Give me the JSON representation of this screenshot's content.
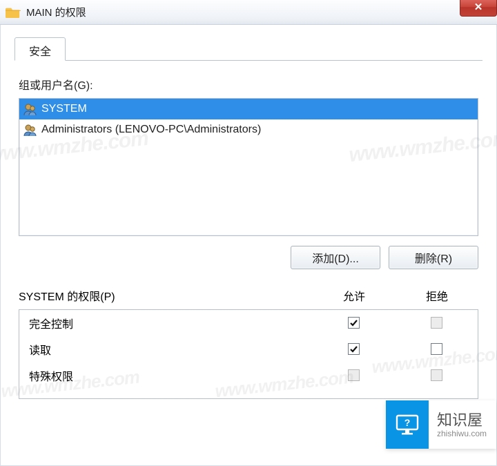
{
  "window": {
    "title": "MAIN 的权限",
    "close_glyph": "✕"
  },
  "tab": {
    "security": "安全"
  },
  "groups_label": "组或用户名(G):",
  "users": [
    {
      "name": "SYSTEM",
      "selected": true
    },
    {
      "name": "Administrators (LENOVO-PC\\Administrators)",
      "selected": false
    }
  ],
  "buttons": {
    "add": "添加(D)...",
    "remove": "删除(R)"
  },
  "perm_header": {
    "label": "SYSTEM 的权限(P)",
    "allow": "允许",
    "deny": "拒绝"
  },
  "permissions": [
    {
      "name": "完全控制",
      "allow": "checked",
      "deny": "disabled"
    },
    {
      "name": "读取",
      "allow": "checked",
      "deny": "unchecked"
    },
    {
      "name": "特殊权限",
      "allow": "disabled",
      "deny": "disabled"
    }
  ],
  "watermark": "www.wmzhe.com",
  "brand": {
    "name": "知识屋",
    "url": "zhishiwu.com"
  }
}
